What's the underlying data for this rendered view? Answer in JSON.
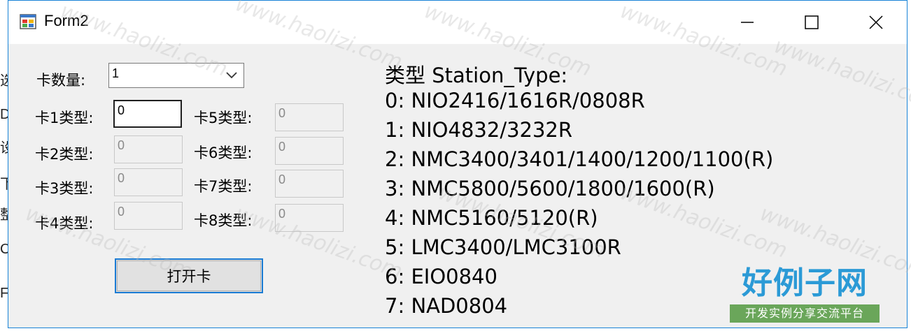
{
  "window": {
    "title": "Form2"
  },
  "edge_glyphs": [
    "选",
    "D",
    "设",
    "下",
    "整",
    "C",
    "F"
  ],
  "form": {
    "card_count_label": "卡数量:",
    "card_count_value": "1",
    "card_types": [
      {
        "label": "卡1类型:",
        "value": "0",
        "enabled": true
      },
      {
        "label": "卡2类型:",
        "value": "0",
        "enabled": false
      },
      {
        "label": "卡3类型:",
        "value": "0",
        "enabled": false
      },
      {
        "label": "卡4类型:",
        "value": "0",
        "enabled": false
      },
      {
        "label": "卡5类型:",
        "value": "0",
        "enabled": false
      },
      {
        "label": "卡6类型:",
        "value": "0",
        "enabled": false
      },
      {
        "label": "卡7类型:",
        "value": "0",
        "enabled": false
      },
      {
        "label": "卡8类型:",
        "value": "0",
        "enabled": false
      }
    ],
    "open_button_label": "打开卡"
  },
  "station_types": {
    "heading": "类型 Station_Type:",
    "lines": [
      "0:  NIO2416/1616R/0808R",
      "1:  NIO4832/3232R",
      "2:  NMC3400/3401/1400/1200/1100(R)",
      "3:  NMC5800/5600/1800/1600(R)",
      "4:  NMC5160/5120(R)",
      "5:  LMC3400/LMC3100R",
      "6:  EIO0840",
      "7:  NAD0804"
    ]
  },
  "watermark": {
    "text": "www.haolizi.com",
    "logo_main": "好例子网",
    "logo_sub": "开发实例分享交流平台"
  },
  "colors": {
    "accent": "#1a7bd3",
    "form_bg": "#f0f0f0",
    "logo_blue": "#2b9ad6",
    "logo_green": "#6aa65a"
  }
}
